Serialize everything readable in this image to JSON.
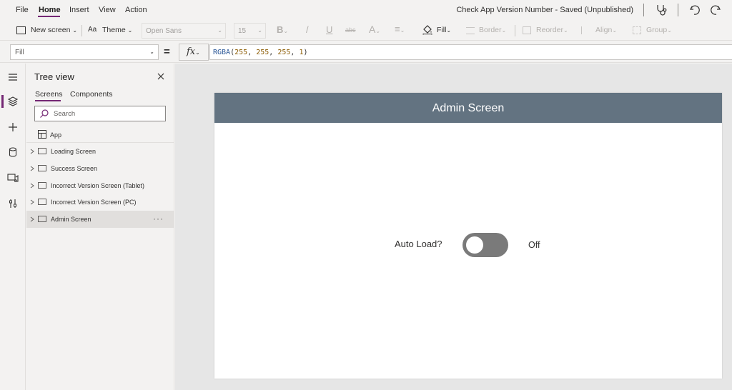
{
  "menu": {
    "items": [
      "File",
      "Home",
      "Insert",
      "View",
      "Action"
    ],
    "active": "Home"
  },
  "app_title": "Check App Version Number - Saved (Unpublished)",
  "toolbar": {
    "new_screen": "New screen",
    "theme": "Theme",
    "font_family": "Open Sans",
    "font_size": "15",
    "bold": "B",
    "italic": "/",
    "underline": "U",
    "strikethrough": "abc",
    "font_color": "A",
    "align": "≡",
    "fill": "Fill",
    "border": "Border",
    "reorder": "Reorder",
    "align_menu": "Align",
    "group": "Group"
  },
  "formula_bar": {
    "property": "Fill",
    "equals": "=",
    "fx": "fx",
    "formula_fn": "RGBA",
    "formula_args": [
      "255",
      "255",
      "255",
      "1"
    ]
  },
  "tree_view": {
    "title": "Tree view",
    "tabs": [
      "Screens",
      "Components"
    ],
    "active_tab": "Screens",
    "search_placeholder": "Search",
    "app_label": "App",
    "screens": [
      {
        "label": "Loading Screen",
        "selected": false
      },
      {
        "label": "Success Screen",
        "selected": false
      },
      {
        "label": "Incorrect Version Screen (Tablet)",
        "selected": false
      },
      {
        "label": "Incorrect Version Screen (PC)",
        "selected": false
      },
      {
        "label": "Admin Screen",
        "selected": true
      }
    ],
    "more_label": "···"
  },
  "canvas": {
    "header_title": "Admin Screen",
    "header_color": "#637381",
    "toggle_label": "Auto Load?",
    "toggle_state": "Off",
    "toggle_on": false
  },
  "colors": {
    "accent": "#742774",
    "toggle_track": "#7a7a7a"
  }
}
